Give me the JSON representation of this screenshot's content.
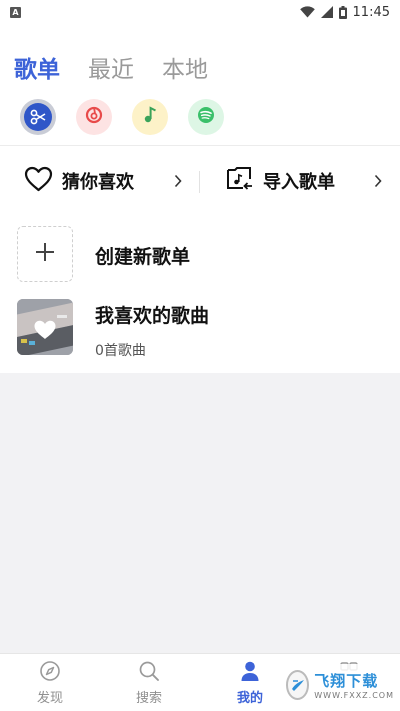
{
  "status_bar": {
    "app_indicator": "A",
    "time": "11:45",
    "icons": [
      "wifi-icon",
      "signal-icon",
      "battery-icon"
    ]
  },
  "tabs": [
    {
      "label": "歌单",
      "active": true
    },
    {
      "label": "最近",
      "active": false
    },
    {
      "label": "本地",
      "active": false
    }
  ],
  "platforms": [
    {
      "icon": "scissors-app-icon",
      "color": "#2f56c8",
      "selected": true
    },
    {
      "icon": "netease-music-icon",
      "color": "#e84a4a"
    },
    {
      "icon": "qq-music-icon",
      "color": "#f2c230"
    },
    {
      "icon": "spotify-icon",
      "color": "#3ac06a"
    }
  ],
  "quick_actions": {
    "guess_like": {
      "label": "猜你喜欢",
      "icon": "heart-outline-icon"
    },
    "import": {
      "label": "导入歌单",
      "icon": "import-playlist-icon"
    }
  },
  "playlists": {
    "create": {
      "label": "创建新歌单",
      "icon": "plus-icon"
    },
    "favorites": {
      "title": "我喜欢的歌曲",
      "count": "0首歌曲",
      "icon": "heart-filled-icon"
    }
  },
  "bottom_nav": [
    {
      "label": "发现",
      "icon": "compass-icon",
      "active": false
    },
    {
      "label": "搜索",
      "icon": "search-icon",
      "active": false
    },
    {
      "label": "我的",
      "icon": "person-icon",
      "active": true
    },
    {
      "label": "",
      "icon": "more-icon",
      "active": false
    }
  ],
  "watermark": {
    "main": "飞翔下载",
    "sub": "WWW.FXXZ.COM"
  },
  "colors": {
    "accent": "#3d63d8",
    "background": "#f2f2f4",
    "card": "#ffffff"
  }
}
